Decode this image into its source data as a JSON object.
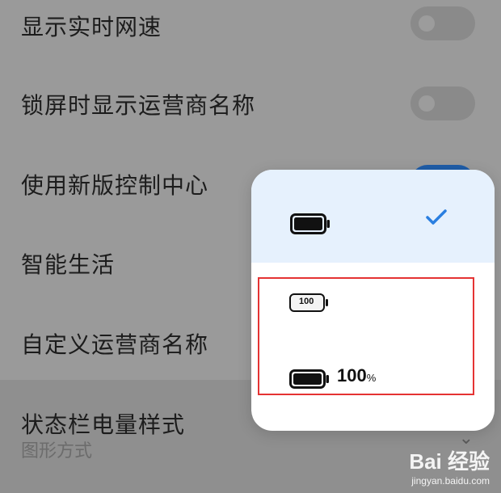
{
  "settings": {
    "items": [
      {
        "label": "显示实时网速",
        "toggle": "off"
      },
      {
        "label": "锁屏时显示运营商名称",
        "toggle": "off"
      },
      {
        "label": "使用新版控制中心",
        "toggle": "on"
      },
      {
        "label": "智能生活"
      },
      {
        "label": "自定义运营商名称"
      },
      {
        "label": "状态栏电量样式",
        "subtitle": "图形方式"
      }
    ]
  },
  "popup": {
    "options": [
      {
        "style": "graphic",
        "selected": true
      },
      {
        "style": "number-in-battery",
        "battery_text": "100",
        "selected": false
      },
      {
        "style": "graphic-with-percent",
        "percent_value": "100",
        "percent_sign": "%",
        "selected": false
      }
    ]
  },
  "watermark": {
    "logo": "Bai 经验",
    "url": "jingyan.baidu.com"
  },
  "colors": {
    "accent": "#1f5da8",
    "check": "#2a7fe0",
    "highlight_border": "#e53333"
  }
}
